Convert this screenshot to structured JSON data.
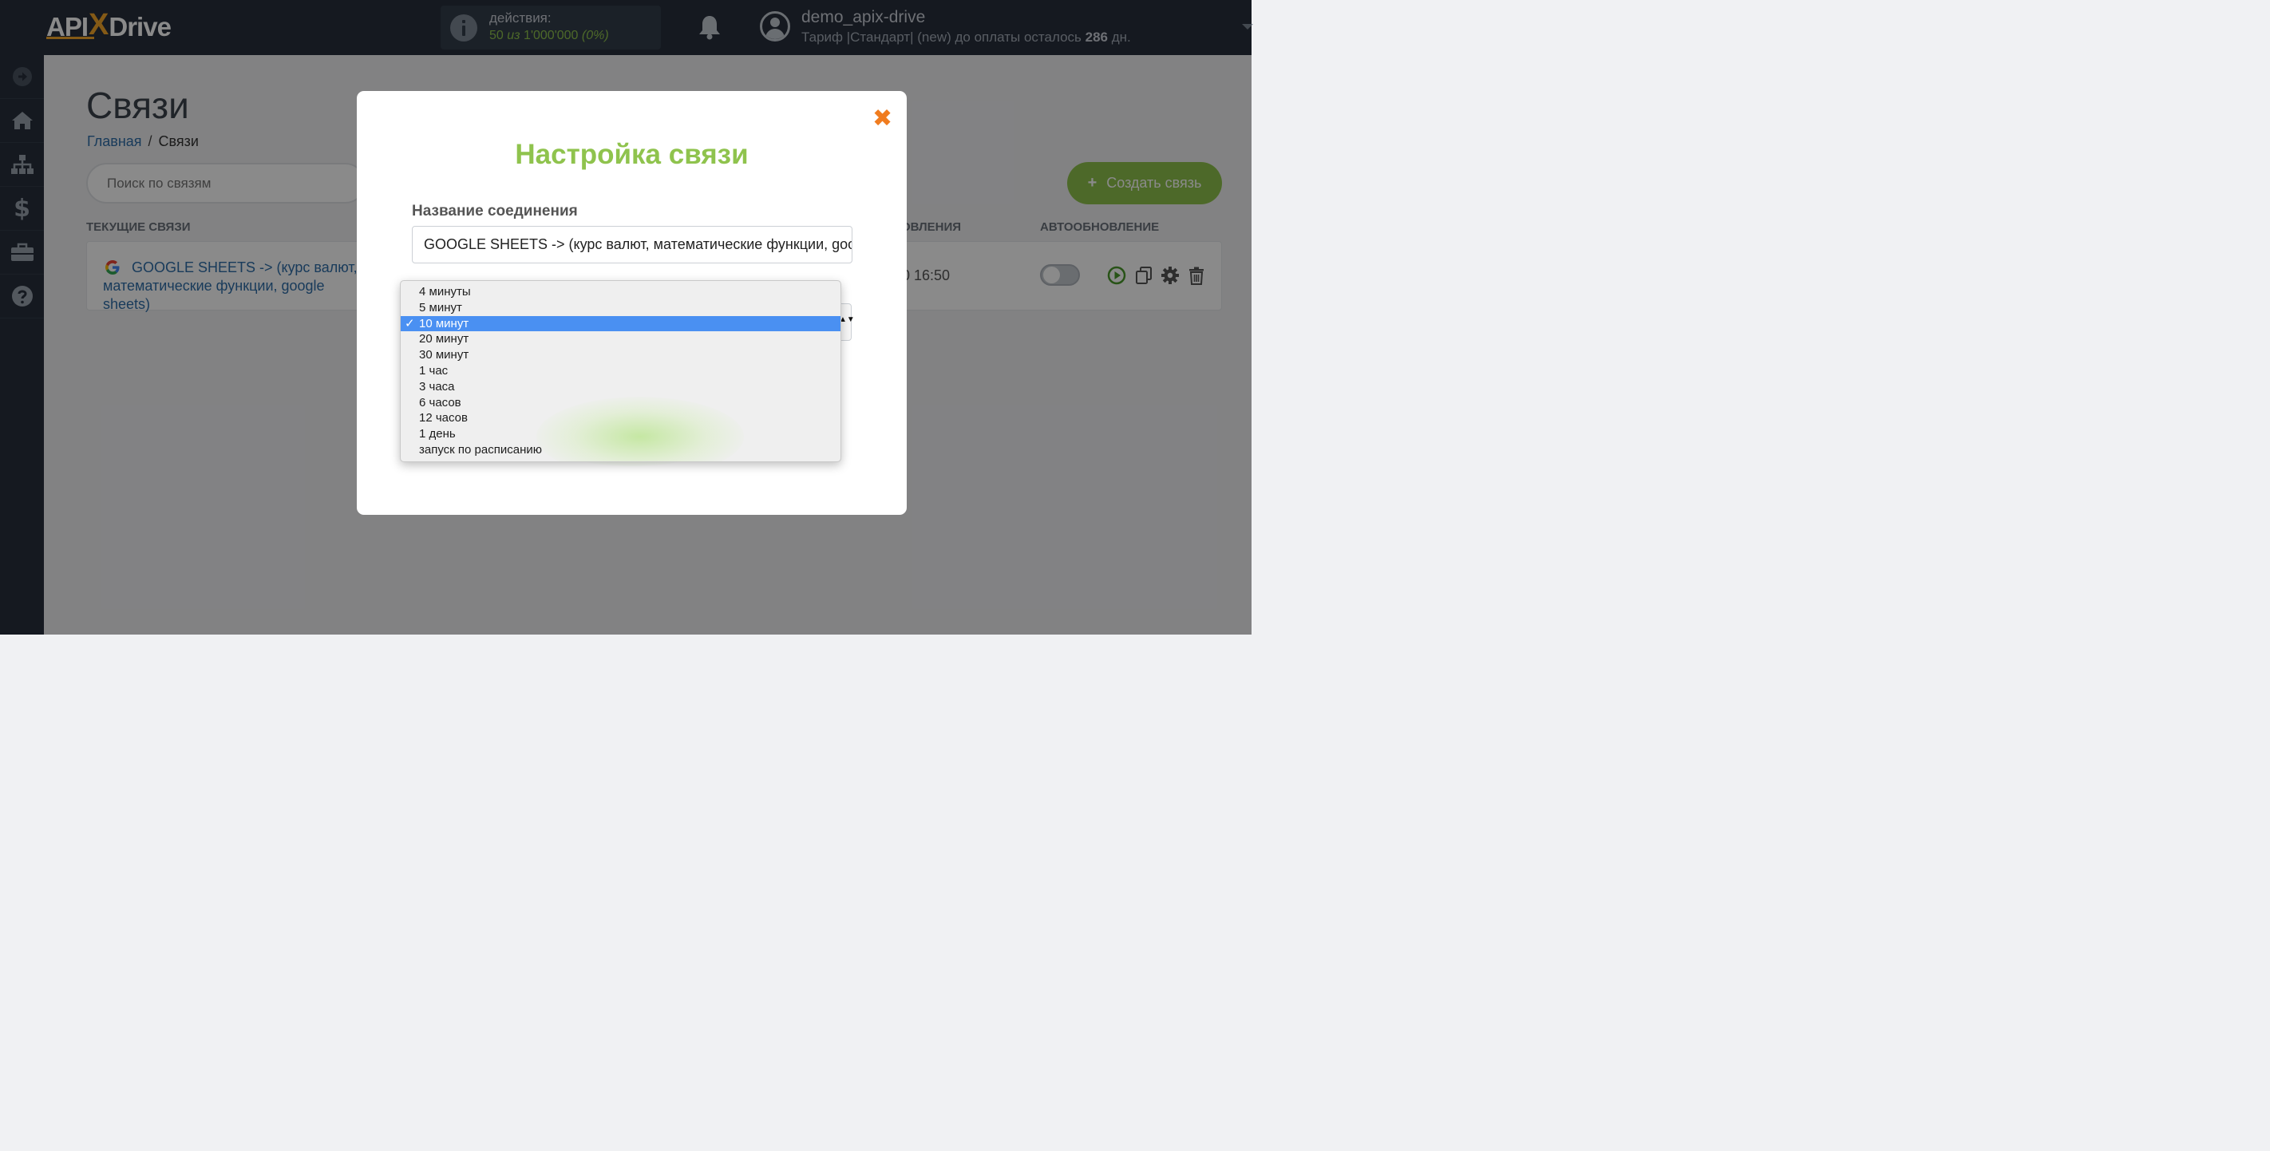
{
  "logo": {
    "part1": "API",
    "part2": "X",
    "part3": "Drive"
  },
  "header": {
    "actions_label": "действия:",
    "actions_used": "50",
    "actions_of": "из",
    "actions_total": "1'000'000",
    "actions_percent": "(0%)",
    "username": "demo_apix-drive",
    "tariff_text": "Тариф |Стандарт| (new) до оплаты осталось",
    "tariff_days": "286",
    "tariff_days_unit": "дн."
  },
  "page": {
    "title": "Связи",
    "breadcrumb_home": "Главная",
    "breadcrumb_sep": "/",
    "breadcrumb_current": "Связи",
    "search_placeholder": "Поиск по связям",
    "create_button_plus": "+",
    "create_button_label": "Создать связь",
    "col_current": "ТЕКУЩИЕ СВЯЗИ",
    "col_update": "ОВЛЕНИЯ",
    "col_autoupdate": "АВТООБНОВЛЕНИЕ"
  },
  "connection_row": {
    "name": "GOOGLE SHEETS -> (курс валют, математические функции, google sheets)",
    "date": "0 16:50"
  },
  "modal": {
    "close_glyph": "✖",
    "title": "Настройка связи",
    "name_label": "Название соединения",
    "name_value": "GOOGLE SHEETS -> (курс валют, математические функции, google sheets)",
    "select_arrows": "▲▼"
  },
  "interval_dropdown": {
    "selected_check": "✓",
    "options": [
      {
        "label": "4 минуты",
        "selected": false
      },
      {
        "label": "5 минут",
        "selected": false
      },
      {
        "label": "10 минут",
        "selected": true
      },
      {
        "label": "20 минут",
        "selected": false
      },
      {
        "label": "30 минут",
        "selected": false
      },
      {
        "label": "1 час",
        "selected": false
      },
      {
        "label": "3 часа",
        "selected": false
      },
      {
        "label": "6 часов",
        "selected": false
      },
      {
        "label": "12 часов",
        "selected": false
      },
      {
        "label": "1 день",
        "selected": false
      },
      {
        "label": "запуск по расписанию",
        "selected": false
      }
    ]
  },
  "colors": {
    "accent_green": "#8fc34d",
    "topbar": "#272f3c",
    "link_blue": "#2f6ea8",
    "close_orange": "#f07c1f",
    "selection_blue": "#4a90f2"
  },
  "icons": {
    "sidebar": [
      "arrow-right-circle-icon",
      "home-icon",
      "sitemap-icon",
      "dollar-icon",
      "briefcase-icon",
      "question-icon"
    ],
    "row_actions": [
      "play-icon",
      "copy-icon",
      "gear-icon",
      "trash-icon"
    ]
  }
}
